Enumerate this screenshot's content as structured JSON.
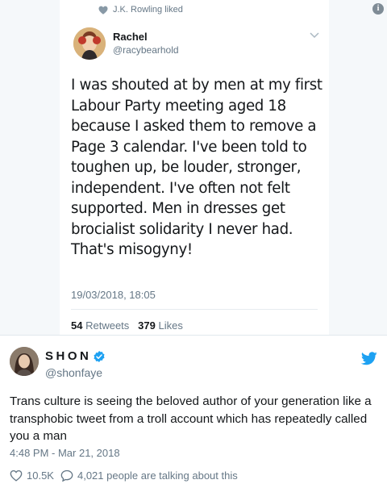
{
  "inner_tweet": {
    "liked_by": "J.K. Rowling liked",
    "author_name": "Rachel",
    "author_handle": "@racybearhold",
    "text": "I was shouted at by men at my first Labour Party meeting aged 18 because I asked them to remove a Page 3 calendar. I've been told to toughen up, be louder, stronger, independent. I've often not felt supported. Men in dresses get brocialist solidarity I never had. That's misogyny!",
    "date": "19/03/2018, 18:05",
    "retweets_count": "54",
    "retweets_label": "Retweets",
    "likes_count": "379",
    "likes_label": "Likes"
  },
  "outer_tweet": {
    "author_name": "SHON",
    "author_handle": "@shonfaye",
    "text": "Trans culture is seeing the beloved author of your generation like a transphobic tweet from a troll account which has repeatedly called you a man",
    "timestamp": "4:48 PM - Mar 21, 2018",
    "likes_count": "10.5K",
    "talking_text": "4,021 people are talking about this"
  },
  "colors": {
    "twitter_blue": "#1da1f2",
    "muted_text": "#657786",
    "body_text": "#14171a"
  },
  "icons": [
    "heart-icon",
    "info-icon",
    "chevron-down-icon",
    "verified-badge-icon",
    "twitter-bird-icon",
    "comment-icon"
  ]
}
